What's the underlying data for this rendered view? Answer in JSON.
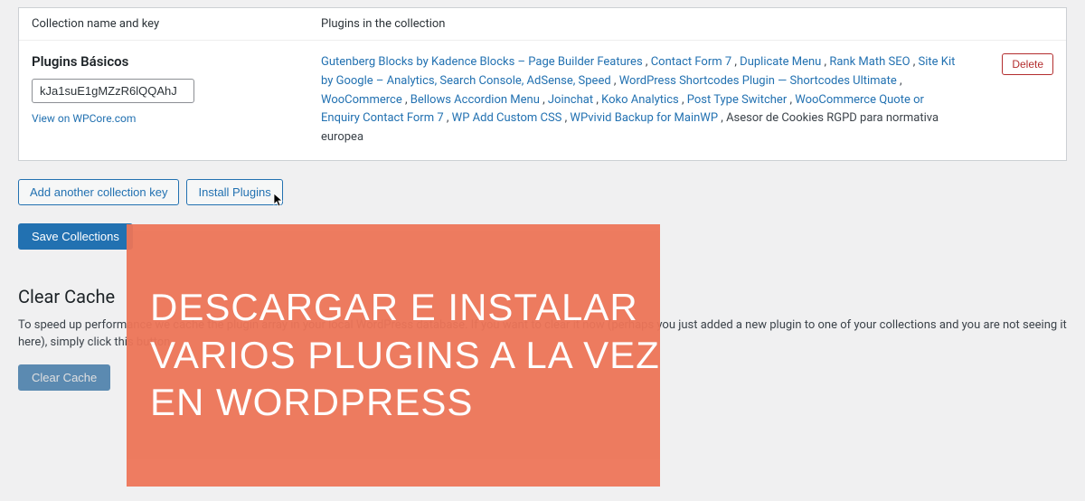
{
  "header": {
    "collection_label": "Collection name and key",
    "plugins_label": "Plugins in the collection"
  },
  "collection": {
    "title": "Plugins Básicos",
    "key": "kJa1suE1gMZzR6lQQAhJ",
    "view_link": "View on WPCore.com",
    "delete_label": "Delete",
    "plugins": [
      "Gutenberg Blocks by Kadence Blocks – Page Builder Features",
      "Contact Form 7",
      "Duplicate Menu",
      "Rank Math SEO",
      "Site Kit by Google – Analytics, Search Console, AdSense, Speed",
      "WordPress Shortcodes Plugin — Shortcodes Ultimate",
      "WooCommerce",
      "Bellows Accordion Menu",
      "Joinchat",
      "Koko Analytics",
      "Post Type Switcher",
      "WooCommerce Quote or Enquiry Contact Form 7",
      "WP Add Custom CSS",
      "WPvivid Backup for MainWP"
    ],
    "plugins_trailing": "Asesor de Cookies RGPD para normativa europea"
  },
  "buttons": {
    "add_key": "Add another collection key",
    "install": "Install Plugins",
    "save": "Save Collections",
    "clear_cache": "Clear Cache"
  },
  "cache_section": {
    "heading": "Clear Cache",
    "text": "To speed up performance we cache the plugin array in your local WordPress database. If you want to clear it now (perhaps you just added a new plugin to one of your collections and you are not seeing it here), simply click this button."
  },
  "overlay": {
    "line1": "Descargar e instalar",
    "line2": "varios plugins a la vez",
    "line3": "en WordPress"
  }
}
